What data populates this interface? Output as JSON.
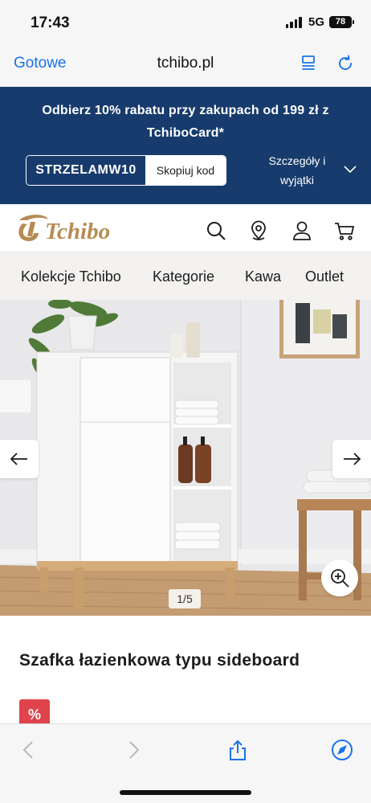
{
  "status_bar": {
    "time": "17:43",
    "network": "5G",
    "battery": "78"
  },
  "browser": {
    "done_label": "Gotowe",
    "url": "tchibo.pl"
  },
  "promo": {
    "text": "Odbierz 10% rabatu przy zakupach od 199 zł z TchiboCard*",
    "coupon_code": "STRZELAMW10",
    "copy_label": "Skopiuj kod",
    "details_label": "Szczegóły i wyjątki"
  },
  "header": {
    "logo_text": "Tchibo"
  },
  "nav": {
    "items": [
      "Kolekcje Tchibo",
      "Kategorie",
      "Kawa",
      "Outlet"
    ]
  },
  "gallery": {
    "counter": "1/5"
  },
  "product": {
    "title": "Szafka łazienkowa typu sideboard",
    "badge": "%"
  },
  "colors": {
    "promo_bg": "#173b6c",
    "accent": "#1a73e8",
    "logo_gold": "#b68c52",
    "badge_red": "#e0434b"
  },
  "icons": [
    "search-icon",
    "store-locator-icon",
    "account-icon",
    "cart-icon",
    "reader-icon",
    "reload-icon",
    "share-icon",
    "compass-icon"
  ]
}
